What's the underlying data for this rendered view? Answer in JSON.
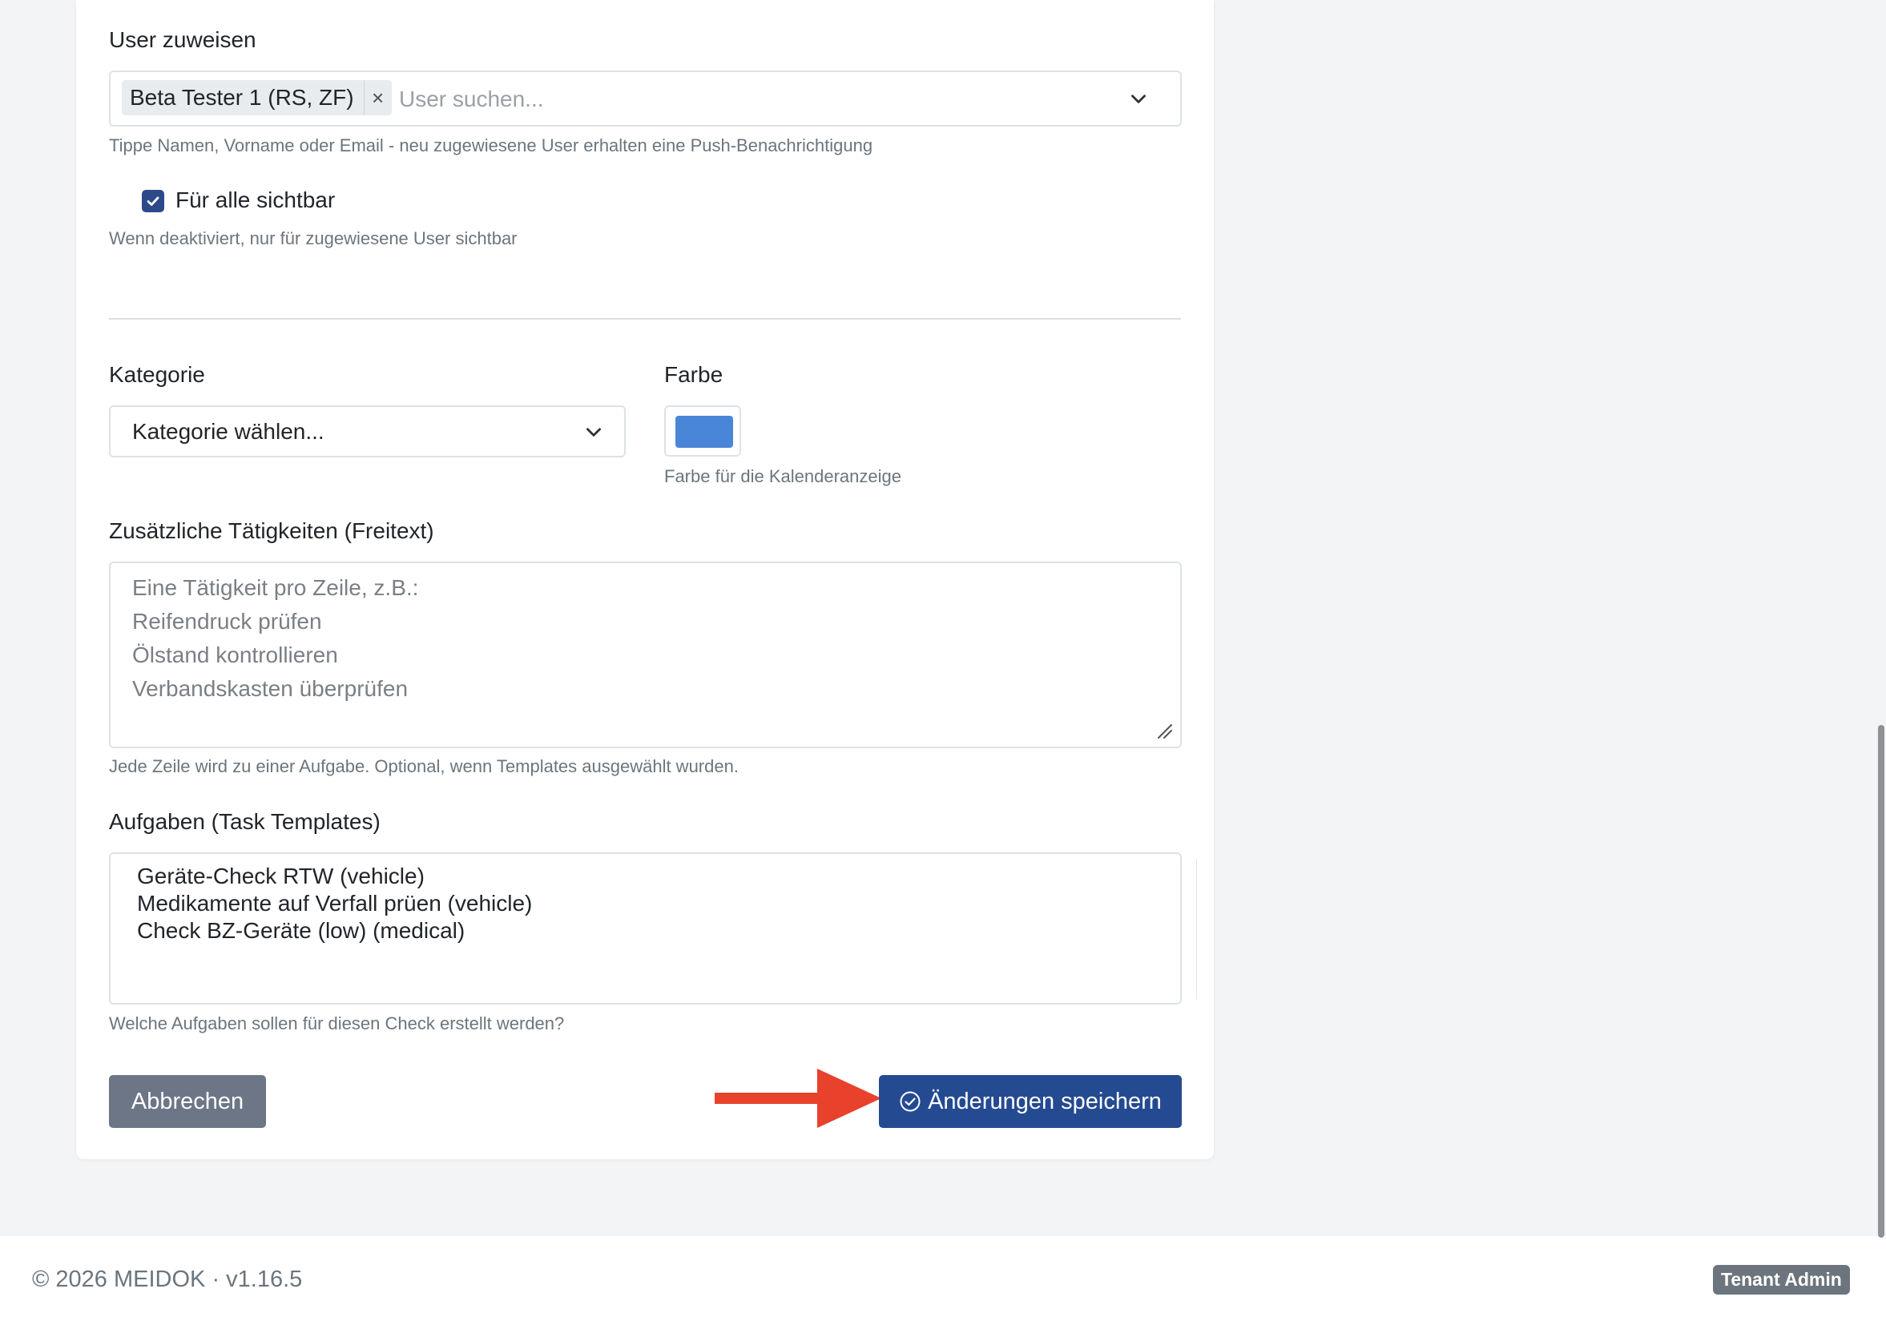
{
  "assign": {
    "label": "User zuweisen",
    "tag": "Beta Tester 1 (RS, ZF)",
    "tag_remove": "×",
    "placeholder": "User suchen...",
    "help": "Tippe Namen, Vorname oder Email - neu zugewiesene User erhalten eine Push-Benachrichtigung"
  },
  "visibility": {
    "checkbox_label": "Für alle sichtbar",
    "checked": true,
    "help": "Wenn deaktiviert, nur für zugewiesene User sichtbar"
  },
  "category": {
    "label": "Kategorie",
    "selected": "Kategorie wählen..."
  },
  "color": {
    "label": "Farbe",
    "value": "#4a86d8",
    "help": "Farbe für die Kalenderanzeige"
  },
  "activities": {
    "label": "Zusätzliche Tätigkeiten (Freitext)",
    "placeholder_lines": [
      "Eine Tätigkeit pro Zeile, z.B.:",
      "Reifendruck prüfen",
      "Ölstand kontrollieren",
      "Verbandskasten überprüfen"
    ],
    "help": "Jede Zeile wird zu einer Aufgabe. Optional, wenn Templates ausgewählt wurden."
  },
  "tasks": {
    "label": "Aufgaben (Task Templates)",
    "options": [
      "Geräte-Check RTW (vehicle)",
      "Medikamente auf Verfall prüen (vehicle)",
      "Check BZ-Geräte (low) (medical)"
    ],
    "help": "Welche Aufgaben sollen für diesen Check erstellt werden?"
  },
  "buttons": {
    "cancel": "Abbrechen",
    "save": "Änderungen speichern"
  },
  "footer": {
    "copyright": "© 2026 MEIDOK · v1.16.5",
    "badge": "Tenant Admin"
  },
  "colors": {
    "primary": "#244a91",
    "secondary": "#6c7686",
    "annotation_arrow": "#e8412c"
  }
}
